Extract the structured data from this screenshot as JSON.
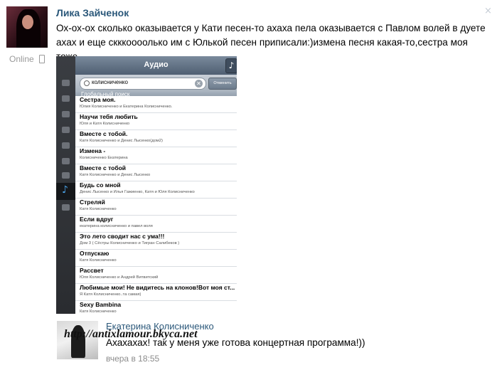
{
  "post": {
    "author": "Лика Зайченок",
    "status": "Online",
    "text": "Ох-ох-ох сколько оказывается у Кати песен-то ахаха пела оказывается с Павлом волей в дуете ахах и еще скккоооолько им с Юлькой песен приписали:)измена песня какая-то,сестра моя тоже..",
    "close_symbol": "×",
    "icons": [
      "phone-icon",
      "close-icon"
    ]
  },
  "screenshot": {
    "title": "Аудио",
    "note_symbol": "♪",
    "search": {
      "value": "колисниченко",
      "clear_symbol": "✕",
      "cancel_label": "Отменить"
    },
    "section": "Глобальный поиск",
    "tracks": [
      {
        "title": "Сестра моя.",
        "artist": "Юлия Колисниченко и Екатерина Колисниченко."
      },
      {
        "title": "Научи тебя любить",
        "artist": "Юля и Катя Колисниченко"
      },
      {
        "title": "Вместе с тобой.",
        "artist": "Катя Колисниченко и Денис Лысенко(дом2)"
      },
      {
        "title": "Измена -",
        "artist": "Колисниченко Екатерина"
      },
      {
        "title": "Вместе с тобой",
        "artist": "Катя Колисниченко и Денис Лысенко"
      },
      {
        "title": "Будь со мной",
        "artist": "Денис Лысенко и Илья Гажиенко, Катя и Юля Колисниченко"
      },
      {
        "title": "Стреляй",
        "artist": "Катя Колисниченко"
      },
      {
        "title": "Если вдруг",
        "artist": "екатерина колисниченко и павел воля"
      },
      {
        "title": "Это лето сводит нас с ума!!!",
        "artist": "Дом 3 ( Сёстры Колисниченко и Тигран Салибеков )"
      },
      {
        "title": "Отпускаю",
        "artist": "Катя Колисниченко"
      },
      {
        "title": "Рассвет",
        "artist": "Юля Колисниченко и Андрей Витвитский"
      },
      {
        "title": "Любимые мои! Не видитесь на клонов!Вот моя ст...",
        "artist": "Я Катя Колисниченко..та самая)"
      },
      {
        "title": "Sexy Bambina",
        "artist": "Катя Колисниченко"
      }
    ]
  },
  "comment": {
    "author": "Екатерина Колисниченко",
    "text": "Ахахахах! так у меня уже готова концертная программа!))",
    "time": "вчера в 18:55",
    "watermark": "http://antixlamour.bkyca.net"
  }
}
